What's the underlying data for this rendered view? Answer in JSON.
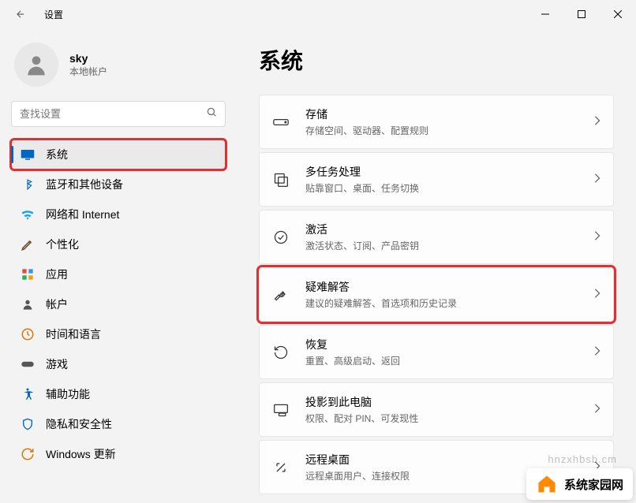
{
  "app": {
    "title": "设置"
  },
  "user": {
    "name": "sky",
    "subtitle": "本地帐户"
  },
  "search": {
    "placeholder": "查找设置"
  },
  "nav": [
    {
      "label": "系统",
      "icon": "system",
      "active": true,
      "highlight": true
    },
    {
      "label": "蓝牙和其他设备",
      "icon": "bluetooth"
    },
    {
      "label": "网络和 Internet",
      "icon": "network"
    },
    {
      "label": "个性化",
      "icon": "personalize"
    },
    {
      "label": "应用",
      "icon": "apps"
    },
    {
      "label": "帐户",
      "icon": "accounts"
    },
    {
      "label": "时间和语言",
      "icon": "time"
    },
    {
      "label": "游戏",
      "icon": "gaming"
    },
    {
      "label": "辅助功能",
      "icon": "accessibility"
    },
    {
      "label": "隐私和安全性",
      "icon": "privacy"
    },
    {
      "label": "Windows 更新",
      "icon": "update"
    }
  ],
  "page": {
    "title": "系统"
  },
  "cards": [
    {
      "title": "存储",
      "desc": "存储空间、驱动器、配置规则",
      "icon": "storage"
    },
    {
      "title": "多任务处理",
      "desc": "贴靠窗口、桌面、任务切换",
      "icon": "multitask"
    },
    {
      "title": "激活",
      "desc": "激活状态、订阅、产品密钥",
      "icon": "activation"
    },
    {
      "title": "疑难解答",
      "desc": "建议的疑难解答、首选项和历史记录",
      "icon": "troubleshoot",
      "highlight": true
    },
    {
      "title": "恢复",
      "desc": "重置、高级启动、返回",
      "icon": "recovery"
    },
    {
      "title": "投影到此电脑",
      "desc": "权限、配对 PIN、可发现性",
      "icon": "projecting"
    },
    {
      "title": "远程桌面",
      "desc": "远程桌面用户、连接权限",
      "icon": "remote"
    }
  ],
  "watermark": "hnzxhbsb.cm",
  "badge": "系统家园网"
}
